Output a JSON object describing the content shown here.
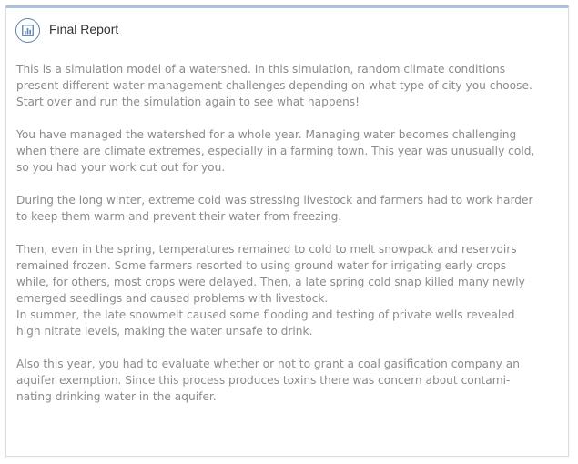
{
  "report": {
    "title": "Final Report",
    "icon": "bar-chart-icon",
    "colors": {
      "header_border": "#a9c2dc",
      "icon": "#5b82ad",
      "text": "#8b8b8b",
      "title": "#333333"
    },
    "paragraphs": [
      {
        "lines": [
          "This is a simulation model of a watershed. In this simulation, random climate conditions",
          "present different water management challenges depending on what type of city you choose.",
          "Start over and run the simulation again to see what happens!"
        ]
      },
      {
        "lines": [
          "You have managed the watershed for a whole year. Managing water becomes challenging",
          "when there are climate extremes, especially in a farming town. This year was unusually cold,",
          "so you had your work cut out for you."
        ]
      },
      {
        "lines": [
          "During the long winter, extreme cold was stressing livestock and farmers had to work harder",
          "to keep them warm and prevent their water from freezing."
        ]
      },
      {
        "lines": [
          "Then, even in the spring, temperatures remained to cold to melt snowpack and reservoirs",
          "remained frozen. Some farmers resorted to using ground water for irrigating early crops",
          "while, for others, most crops were delayed. Then, a late spring cold snap killed many newly",
          "emerged seedlings and caused problems with livestock.",
          "In summer, the late snowmelt caused some flooding and testing of private wells revealed",
          "high nitrate levels, making the water unsafe to drink."
        ]
      },
      {
        "lines": [
          "Also this year, you had to evaluate whether or not to grant a coal gasification company an",
          "aquifer exemption. Since this process produces toxins there was concern about contami-",
          "nating drinking water in the aquifer."
        ]
      }
    ]
  }
}
